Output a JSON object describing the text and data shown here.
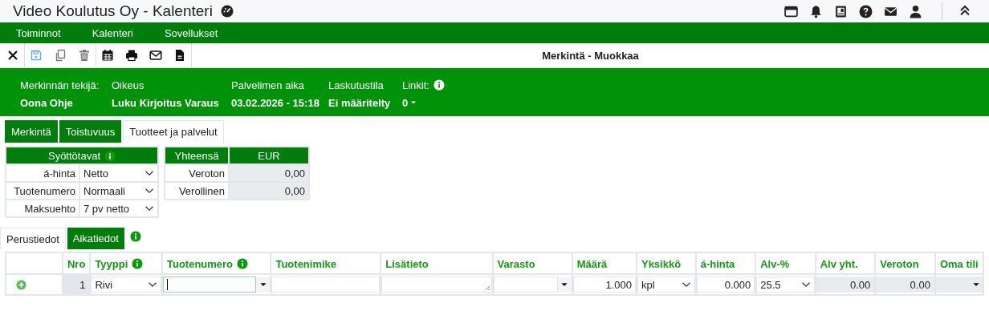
{
  "window": {
    "title": "Video Koulutus Oy - Kalenteri"
  },
  "menu": [
    "Toiminnot",
    "Kalenteri",
    "Sovellukset"
  ],
  "toolbar": {
    "title": "Merkintä - Muokkaa"
  },
  "info": [
    {
      "label": "Merkinnän tekijä:",
      "value": "Oona Ohje",
      "kind": "text"
    },
    {
      "label": "Oikeus",
      "value": "Luku Kirjoitus Varaus",
      "kind": "text"
    },
    {
      "label": "Palvelimen aika",
      "value": "03.02.2026 - 15:18",
      "kind": "text"
    },
    {
      "label": "Laskutustila",
      "value": "Ei määritelty",
      "kind": "text"
    },
    {
      "label": "Linkit:",
      "value": "0",
      "kind": "dropdown"
    }
  ],
  "tabs": [
    {
      "label": "Merkintä",
      "selected": false
    },
    {
      "label": "Toistuvuus",
      "selected": false
    },
    {
      "label": "Tuotteet ja palvelut",
      "selected": true
    }
  ],
  "settings": {
    "title": "Syöttötavat",
    "rows": [
      {
        "label": "á-hinta",
        "value": "Netto"
      },
      {
        "label": "Tuotenumero",
        "value": "Normaali"
      },
      {
        "label": "Maksuehto",
        "value": "7 pv netto"
      }
    ]
  },
  "totals": {
    "columns": [
      "Yhteensä",
      "EUR"
    ],
    "rows": [
      {
        "label": "Veroton",
        "value": "0,00"
      },
      {
        "label": "Verollinen",
        "value": "0,00"
      }
    ]
  },
  "subtabs": [
    {
      "label": "Perustiedot",
      "selected": true
    },
    {
      "label": "Aikatiedot",
      "selected": false
    }
  ],
  "lines": {
    "columns": [
      {
        "label": "Nro",
        "info": false
      },
      {
        "label": "Tyyppi",
        "info": true
      },
      {
        "label": "Tuotenumero",
        "info": true
      },
      {
        "label": "Tuotenimike",
        "info": false
      },
      {
        "label": "Lisätieto",
        "info": false
      },
      {
        "label": "Varasto",
        "info": false
      },
      {
        "label": "Määrä",
        "info": false
      },
      {
        "label": "Yksikkö",
        "info": false
      },
      {
        "label": "á-hinta",
        "info": false
      },
      {
        "label": "Alv-%",
        "info": false
      },
      {
        "label": "Alv yht.",
        "info": false
      },
      {
        "label": "Veroton",
        "info": false
      },
      {
        "label": "Oma tili",
        "info": false
      }
    ],
    "rows": [
      {
        "cells": [
          {
            "kind": "index",
            "value": "1",
            "focused": false
          },
          {
            "kind": "select",
            "value": "Rivi",
            "focused": false
          },
          {
            "kind": "combo",
            "focused": true
          },
          {
            "kind": "text",
            "focused": false
          },
          {
            "kind": "textarea",
            "focused": false
          },
          {
            "kind": "combo",
            "focused": false
          },
          {
            "kind": "number",
            "value": "1.000",
            "focused": false
          },
          {
            "kind": "select",
            "value": "kpl",
            "focused": false
          },
          {
            "kind": "number",
            "value": "0.000",
            "focused": false
          },
          {
            "kind": "select",
            "value": "25.5",
            "focused": false
          },
          {
            "kind": "readonly",
            "value": "0.00",
            "focused": false
          },
          {
            "kind": "readonly",
            "value": "0.00",
            "focused": false
          },
          {
            "kind": "readonly-combo",
            "focused": false
          }
        ]
      }
    ]
  }
}
